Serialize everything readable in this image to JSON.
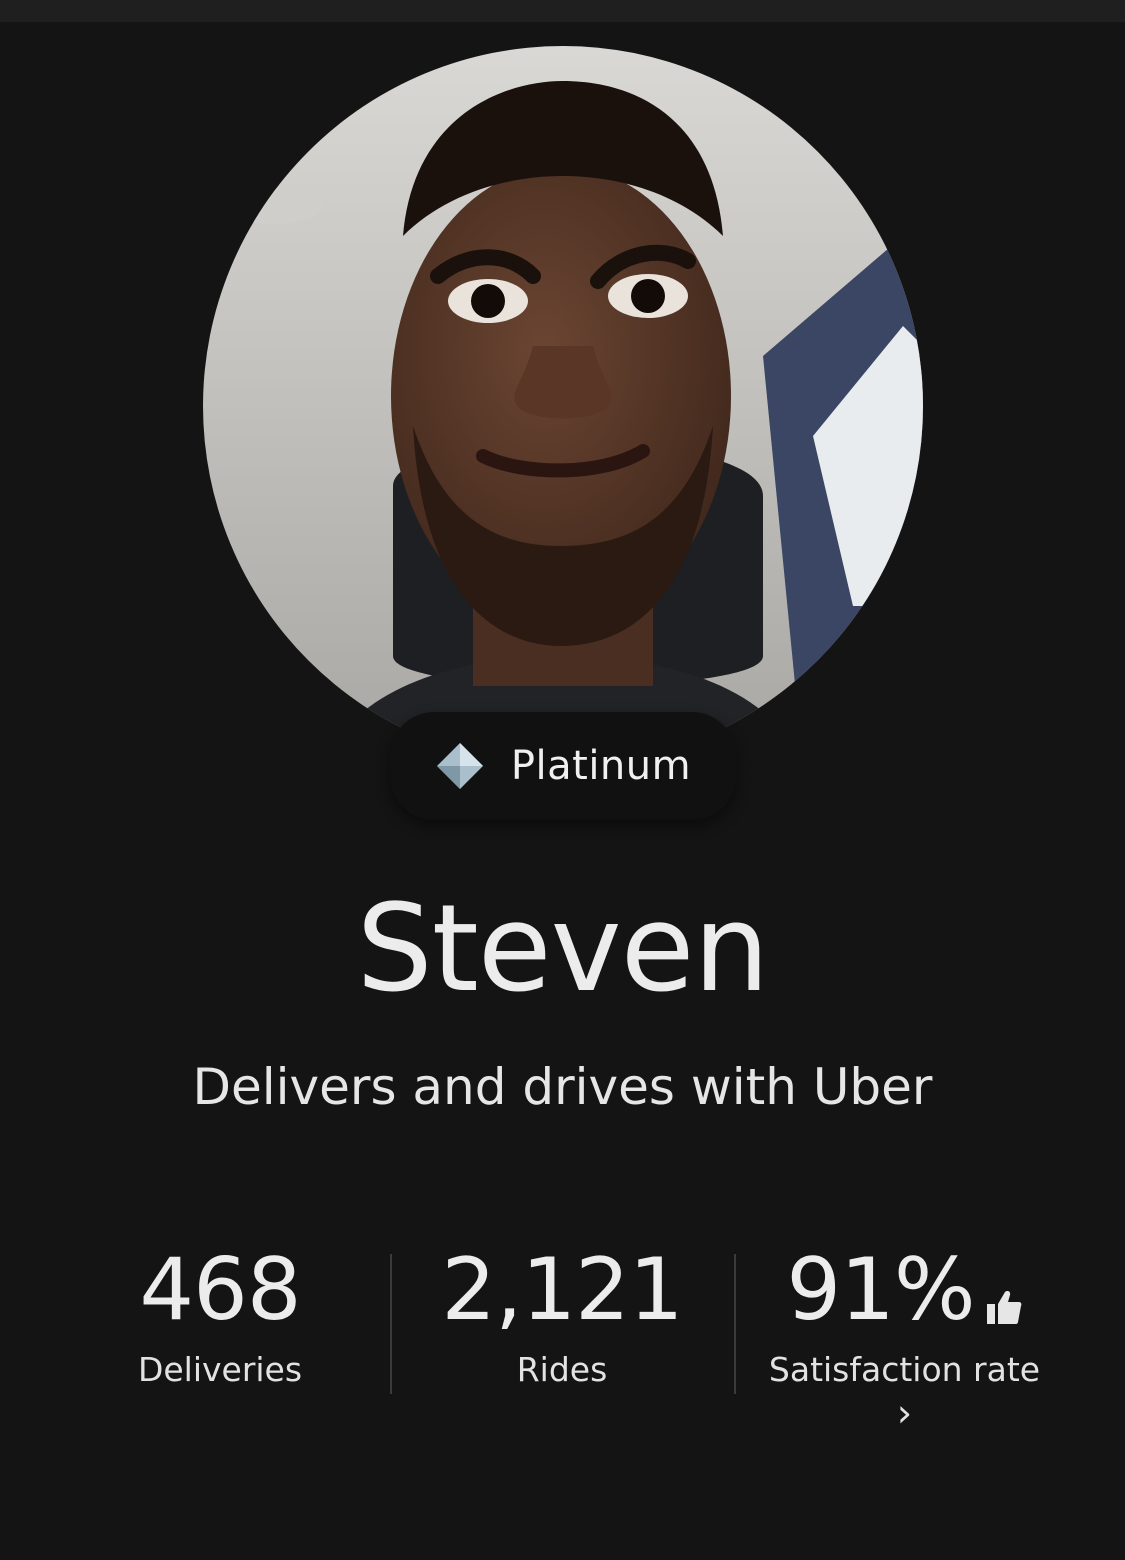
{
  "profile": {
    "avatar_alt": "Profile photo",
    "tier": "Platinum",
    "tier_icon": "diamond-icon",
    "name": "Steven",
    "subtitle": "Delivers and drives with Uber"
  },
  "stats": [
    {
      "value": "468",
      "label": "Deliveries"
    },
    {
      "value": "2,121",
      "label": "Rides"
    },
    {
      "value": "91%",
      "label": "Satisfaction rate",
      "icon": "thumbs-up-icon",
      "chevron": "›"
    }
  ],
  "colors": {
    "background": "#141414",
    "text": "#ececec",
    "badge_bg": "#111111"
  }
}
